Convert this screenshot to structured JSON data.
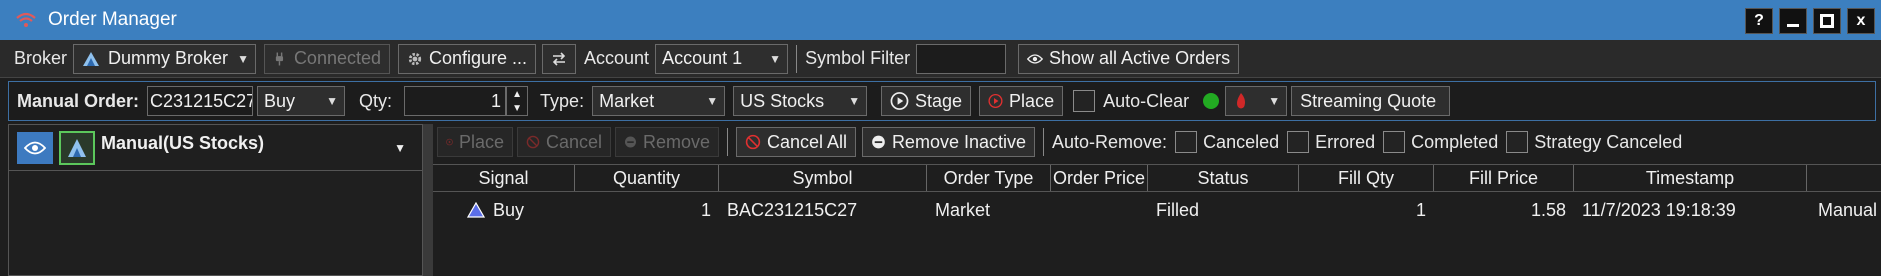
{
  "window": {
    "title": "Order Manager"
  },
  "title_buttons": [
    "?",
    "—",
    "□",
    "x"
  ],
  "toolbar": {
    "broker_label": "Broker",
    "broker_value": "Dummy Broker",
    "connected_label": "Connected",
    "configure_label": "Configure ...",
    "account_label": "Account",
    "account_value": "Account 1",
    "symbol_filter_label": "Symbol Filter",
    "symbol_filter_value": "",
    "show_active_label": "Show all Active Orders"
  },
  "manual_order": {
    "label": "Manual Order:",
    "symbol_value": "C231215C27",
    "side_value": "Buy",
    "qty_label": "Qty:",
    "qty_value": "1",
    "type_label": "Type:",
    "type_value": "Market",
    "market_value": "US Stocks",
    "stage_label": "Stage",
    "place_label": "Place",
    "auto_clear_label": "Auto-Clear",
    "streaming_quote_label": "Streaming Quote"
  },
  "strategy_panel": {
    "title": "Manual(US Stocks)"
  },
  "orders_toolbar": {
    "place_label": "Place",
    "cancel_label": "Cancel",
    "remove_label": "Remove",
    "cancel_all_label": "Cancel All",
    "remove_inactive_label": "Remove Inactive",
    "auto_remove_label": "Auto-Remove:",
    "canceled_label": "Canceled",
    "errored_label": "Errored",
    "completed_label": "Completed",
    "strategy_canceled_label": "Strategy Canceled"
  },
  "orders_table": {
    "columns": [
      "Signal",
      "Quantity",
      "Symbol",
      "Order Type",
      "Order Price",
      "Status",
      "Fill Qty",
      "Fill Price",
      "Timestamp",
      ""
    ],
    "rows": [
      {
        "signal": "Buy",
        "quantity": "1",
        "symbol": "BAC231215C27",
        "order_type": "Market",
        "order_price": "",
        "status": "Filled",
        "fill_qty": "1",
        "fill_price": "1.58",
        "timestamp": "11/7/2023 19:18:39",
        "source": "Manual"
      }
    ]
  },
  "colors": {
    "titlebar": "#3c7fbf",
    "accent_red": "#d03030",
    "status_green": "#22aa22"
  }
}
